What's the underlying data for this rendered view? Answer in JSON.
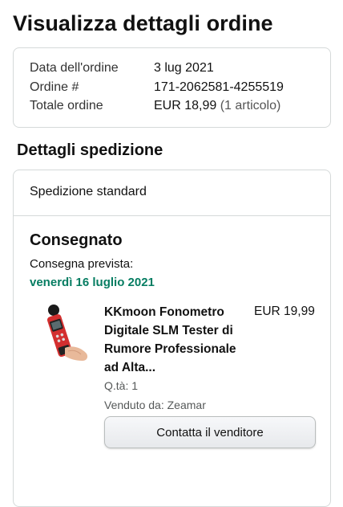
{
  "page": {
    "title": "Visualizza dettagli ordine"
  },
  "summary": {
    "date_label": "Data dell'ordine",
    "date_value": "3 lug 2021",
    "order_label": "Ordine #",
    "order_value": "171-2062581-4255519",
    "total_label": "Totale ordine",
    "total_value": "EUR 18,99",
    "total_items": "(1 articolo)"
  },
  "shipment": {
    "section_title": "Dettagli spedizione",
    "method": "Spedizione standard",
    "status": "Consegnato",
    "expected_label": "Consegna prevista:",
    "expected_date": "venerdì 16 luglio 2021",
    "status_color": "#067d62"
  },
  "item": {
    "title": "KKmoon Fonometro Digitale SLM Tester di Rumore Professionale ad Alta...",
    "price": "EUR 19,99",
    "quantity": "Q.tà: 1",
    "seller": "Venduto da: Zeamar",
    "image_icon": "sound-level-meter"
  },
  "actions": {
    "contact_seller": "Contatta il venditore"
  }
}
